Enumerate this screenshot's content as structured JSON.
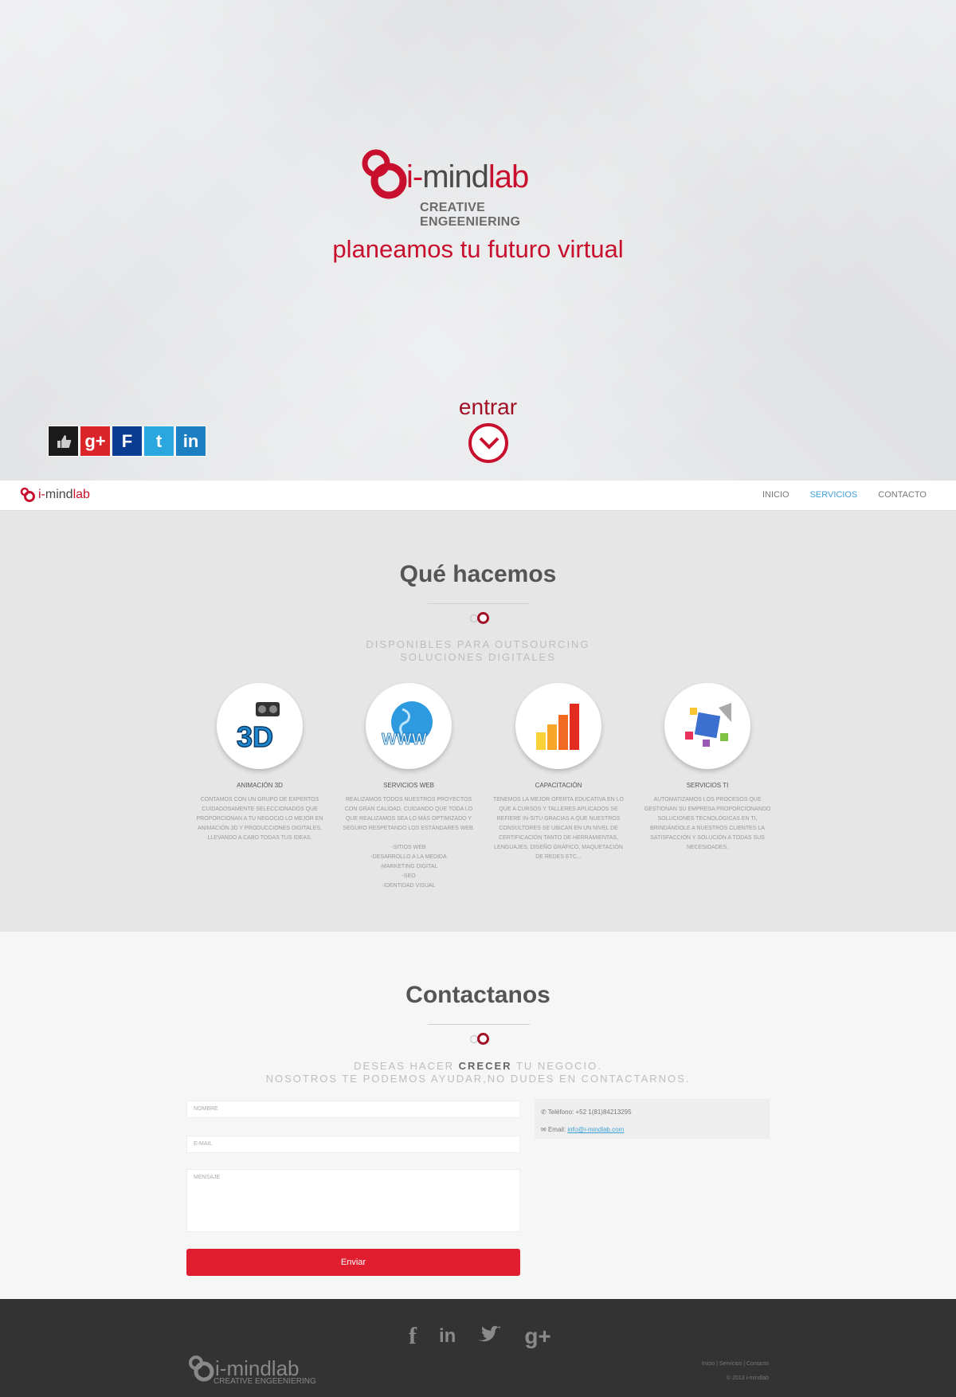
{
  "hero": {
    "brand_i": "i-",
    "brand_mind": "mind",
    "brand_lab": "lab",
    "brand_sub": "CREATIVE ENGEENIERING",
    "tagline": "planeamos tu futuro virtual",
    "enter_label": "entrar",
    "social": [
      "like-icon",
      "google-plus-icon",
      "facebook-icon",
      "twitter-icon",
      "linkedin-icon"
    ],
    "social_letters": {
      "google": "g+",
      "facebook": "F",
      "twitter": "t",
      "linkedin": "in"
    }
  },
  "nav": {
    "brand_i": "i-",
    "brand_mind": "mind",
    "brand_lab": "lab",
    "items": [
      {
        "label": "INICIO",
        "active": false
      },
      {
        "label": "SERVICIOS",
        "active": true
      },
      {
        "label": "CONTACTO",
        "active": false
      }
    ]
  },
  "services": {
    "title": "Qué hacemos",
    "subtitle_1": "DISPONIBLES PARA OUTSOURCING",
    "subtitle_2": "SOLUCIONES DIGITALES",
    "items": [
      {
        "icon": "3d-animation-icon",
        "title": "ANIMACIÓN 3D",
        "text": "CONTAMOS CON UN GRUPO DE EXPERTOS CUIDADOSAMENTE SELECCIONADOS QUE PROPORCIONAN A TU NEGOCIO LO MEJOR EN ANIMACIÓN 3D Y PRODUCCIONES DIGITALES, LLEVANDO A CABO TODAS TUS IDEAS."
      },
      {
        "icon": "www-globe-icon",
        "title": "SERVICIOS WEB",
        "text": "REALIZAMOS TODOS NUESTROS PROYECTOS CON GRAN CALIDAD, CUIDANDO QUE TODA LO QUE REALIZAMOS SEA LO MÁS OPTIMIZADO Y SEGURO RESPETANDO LOS ESTÁNDARES WEB.",
        "list": [
          "-SITIOS WEB",
          "-DESARROLLO A LA MEDIDA",
          "-MARKETING DIGITAL",
          "-SEO",
          "-IDENTIDAD VISUAL"
        ]
      },
      {
        "icon": "bar-chart-icon",
        "title": "CAPACITACIÓN",
        "text": "TENEMOS LA MEJOR OFERTA EDUCATIVA EN LO QUE A CURSOS Y TALLERES APLICADOS SE REFIERE IN-SITU GRACIAS A QUE NUESTROS CONSULTORES SE UBICAN EN UN NIVEL DE CERTIFICACIÓN TANTO DE HERRAMIENTAS, LENGUAJES, DISEÑO GRÁFICO, MAQUETACIÓN DE REDES ETC..."
      },
      {
        "icon": "it-cube-icon",
        "title": "SERVICIOS TI",
        "text": "AUTOMATIZAMOS LOS PROCESOS QUE GESTIONAN SU EMPRESA PROPORCIONANDO SOLUCIONES TECNOLÓGICAS EN TI, BRINDÁNDOLE A NUESTROS CLIENTES LA SATISFACCIÓN Y SOLUCIÓN A TODAS SUS NECESIDADES."
      }
    ]
  },
  "contact": {
    "title": "Contactanos",
    "line1_a": "DESEAS HACER ",
    "line1_b": "CRECER",
    "line1_c": " TU NEGOCIO.",
    "line2": "NOSOTROS TE PODEMOS AYUDAR,NO DUDES EN CONTACTARNOS.",
    "name_placeholder": "NOMBRE",
    "email_placeholder": "E-MAIL",
    "message_placeholder": "MENSAJE",
    "send_label": "Enviar",
    "phone_label": "Teléfono: +52 1(81)84213295",
    "email_label": "Email: ",
    "email_value": "info@i-mindlab.com"
  },
  "footer": {
    "brand_i": "i-",
    "brand_rest": "mindlab",
    "brand_sub": "CREATIVE ENGEENIERING",
    "icons": [
      "facebook-icon",
      "linkedin-icon",
      "twitter-icon",
      "google-plus-icon"
    ],
    "icon_letters": {
      "facebook": "f",
      "linkedin": "in",
      "google": "g+"
    },
    "links": "Inicio | Servicios | Contacto",
    "copyright": "© 2013 i-mindlab"
  },
  "colors": {
    "brand_red": "#c8102e",
    "button_red": "#e01e2f",
    "link_blue": "#3fa0d8",
    "footer_bg": "#333333"
  }
}
